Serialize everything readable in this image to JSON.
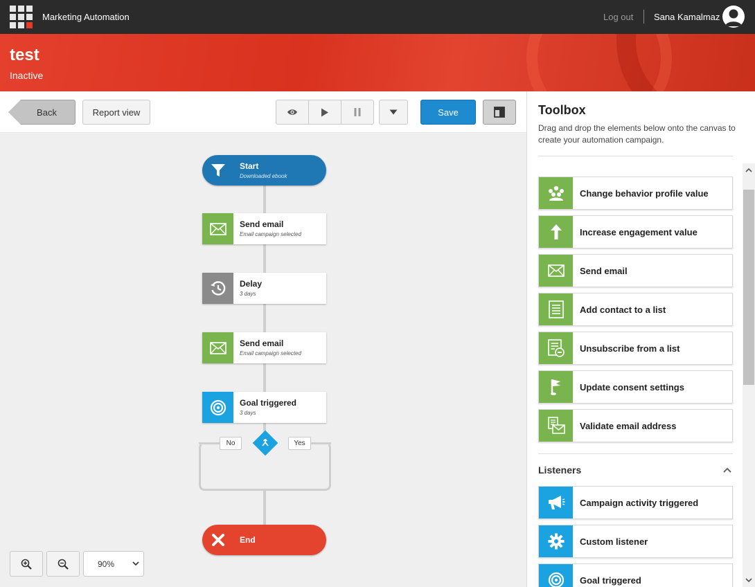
{
  "header": {
    "app_title": "Marketing Automation",
    "logout": "Log out",
    "user_name": "Sana Kamalmaz"
  },
  "banner": {
    "title": "test",
    "status": "Inactive"
  },
  "toolbar": {
    "back": "Back",
    "report_view": "Report view",
    "save": "Save"
  },
  "canvas": {
    "start": {
      "title": "Start",
      "subtitle": "Downloaded ebook"
    },
    "nodes": [
      {
        "title": "Send email",
        "subtitle": "Email campaign selected",
        "icon": "envelope-icon"
      },
      {
        "title": "Delay",
        "subtitle": "3 days",
        "icon": "clock-icon"
      },
      {
        "title": "Send email",
        "subtitle": "Email campaign selected",
        "icon": "envelope-icon"
      },
      {
        "title": "Goal triggered",
        "subtitle": "3 days",
        "icon": "target-icon"
      }
    ],
    "branch": {
      "no": "No",
      "yes": "Yes"
    },
    "end": {
      "title": "End"
    },
    "zoom": "90%"
  },
  "toolbox": {
    "title": "Toolbox",
    "description": "Drag and drop the elements below onto the canvas to create your automation campaign.",
    "actions": [
      {
        "label": "Change behavior profile value",
        "icon": "people-icon"
      },
      {
        "label": "Increase engagement value",
        "icon": "arrow-up-icon"
      },
      {
        "label": "Send email",
        "icon": "envelope-icon"
      },
      {
        "label": "Add contact to a list",
        "icon": "list-icon"
      },
      {
        "label": "Unsubscribe from a list",
        "icon": "list-minus-icon"
      },
      {
        "label": "Update consent settings",
        "icon": "flag-icon"
      },
      {
        "label": "Validate email address",
        "icon": "email-check-icon"
      }
    ],
    "listeners_title": "Listeners",
    "listeners": [
      {
        "label": "Campaign activity triggered",
        "icon": "megaphone-icon"
      },
      {
        "label": "Custom listener",
        "icon": "gear-icon"
      },
      {
        "label": "Goal triggered",
        "icon": "target-icon"
      }
    ]
  },
  "colors": {
    "accent": "#1e8bd0",
    "action_green": "#7ab44f",
    "listener_blue": "#1aa3e0",
    "brand_red": "#e4402d",
    "start_blue": "#1f77b4"
  }
}
